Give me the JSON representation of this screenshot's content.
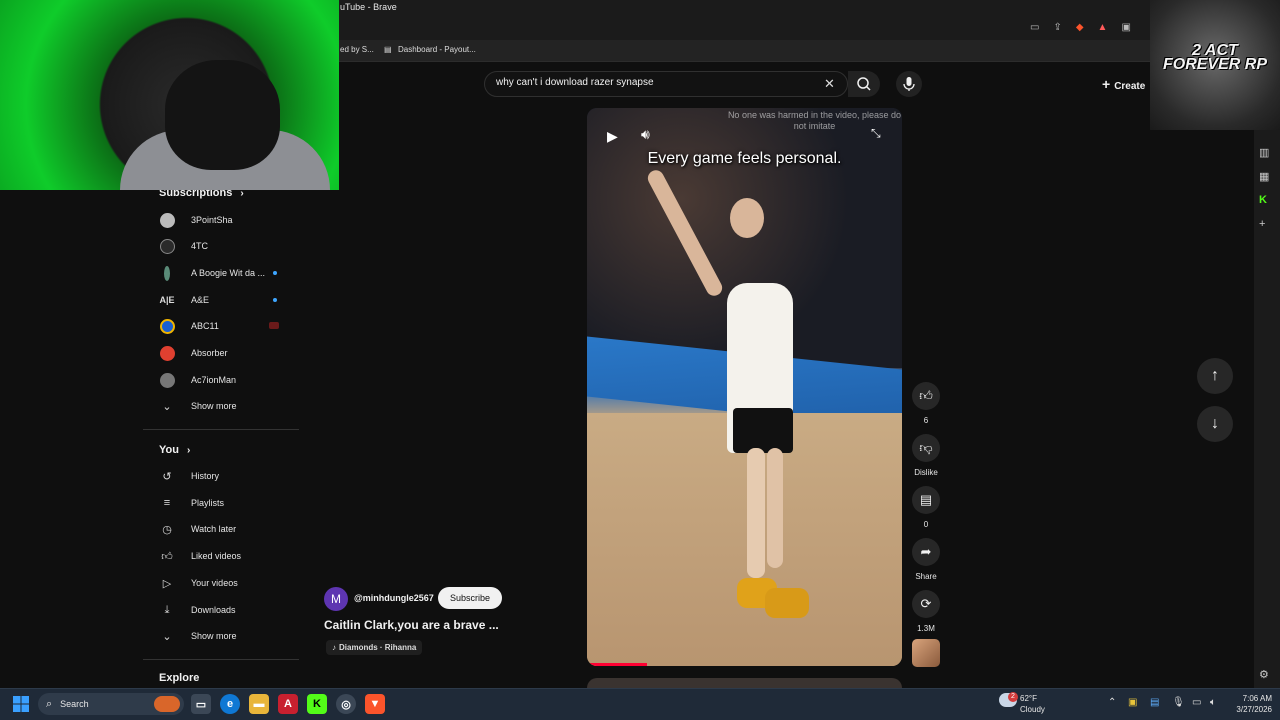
{
  "browser": {
    "title": "uTube - Brave",
    "bookmarks": [
      {
        "label": "ed by S..."
      },
      {
        "label": "Dashboard - Payout..."
      }
    ]
  },
  "youtube": {
    "search": {
      "value": "why can't i download razer synapse"
    },
    "create_label": "Create",
    "sidebar": {
      "subscriptions_header": "Subscriptions",
      "subscriptions": [
        {
          "label": "3PointSha"
        },
        {
          "label": "4TC"
        },
        {
          "label": "A Boogie Wit da ..."
        },
        {
          "label": "A&E"
        },
        {
          "label": "ABC11"
        },
        {
          "label": "Absorber"
        },
        {
          "label": "Ac7ionMan"
        }
      ],
      "show_more_1": "Show more",
      "you_header": "You",
      "you_items": [
        {
          "label": "History",
          "icon": "history-icon"
        },
        {
          "label": "Playlists",
          "icon": "playlists-icon"
        },
        {
          "label": "Watch later",
          "icon": "watch-later-icon"
        },
        {
          "label": "Liked videos",
          "icon": "liked-videos-icon"
        },
        {
          "label": "Your videos",
          "icon": "your-videos-icon"
        },
        {
          "label": "Downloads",
          "icon": "downloads-icon"
        }
      ],
      "show_more_2": "Show more",
      "explore_header": "Explore"
    },
    "short": {
      "caption": "Every game feels personal.",
      "disclaimer": "No one was harmed in the video, please do not imitate",
      "channel_initial": "M",
      "channel": "@minhdungle2567",
      "subscribe_label": "Subscribe",
      "title": "Caitlin Clark,you are a brave ...",
      "music": "Diamonds · Rihanna",
      "likes": "6",
      "dislike_label": "Dislike",
      "comments": "0",
      "share_label": "Share",
      "remix_count": "1.3M"
    }
  },
  "overlay": {
    "logo_text": "2 ACT FOREVER RP"
  },
  "taskbar": {
    "search_label": "Search",
    "weather_temp": "62°F",
    "weather_cond": "Cloudy",
    "time": "7:06 AM",
    "date": "3/27/2026",
    "weather_badge": "2"
  },
  "colors": {
    "accent_red": "#ff0033",
    "webcam_green": "#0fcc2a",
    "channel_avatar": "#5e35b1"
  }
}
